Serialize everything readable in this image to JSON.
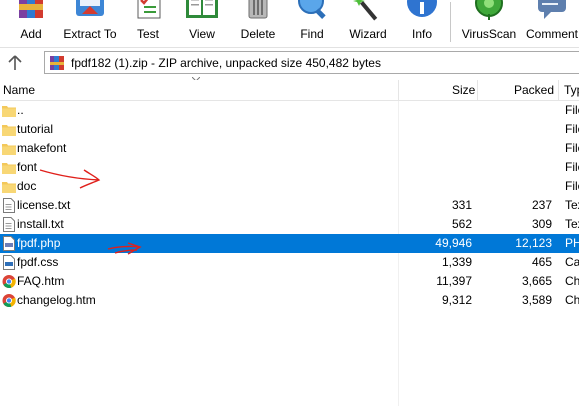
{
  "toolbar": {
    "buttons": [
      {
        "label": "Add",
        "icon": "winrar-books-icon"
      },
      {
        "label": "Extract To",
        "icon": "extract-folder-icon"
      },
      {
        "label": "Test",
        "icon": "test-checklist-icon"
      },
      {
        "label": "View",
        "icon": "open-book-icon"
      },
      {
        "label": "Delete",
        "icon": "trash-can-icon"
      },
      {
        "label": "Find",
        "icon": "magnifier-icon"
      },
      {
        "label": "Wizard",
        "icon": "magic-wand-icon"
      },
      {
        "label": "Info",
        "icon": "info-icon"
      },
      {
        "label": "VirusScan",
        "icon": "virus-scan-icon"
      },
      {
        "label": "Comment",
        "icon": "comment-icon"
      }
    ]
  },
  "address": {
    "path": "fpdf182 (1).zip - ZIP archive, unpacked size 450,482 bytes",
    "icon": "winrar-archive-icon",
    "up_icon": "up-arrow-icon"
  },
  "columns": {
    "name": "Name",
    "size": "Size",
    "packed": "Packed",
    "type": "Typ"
  },
  "files": [
    {
      "name": "..",
      "size": "",
      "packed": "",
      "type": "File",
      "icon": "folder-icon"
    },
    {
      "name": "tutorial",
      "size": "",
      "packed": "",
      "type": "File",
      "icon": "folder-icon"
    },
    {
      "name": "makefont",
      "size": "",
      "packed": "",
      "type": "File",
      "icon": "folder-icon"
    },
    {
      "name": "font",
      "size": "",
      "packed": "",
      "type": "File",
      "icon": "folder-icon"
    },
    {
      "name": "doc",
      "size": "",
      "packed": "",
      "type": "File",
      "icon": "folder-icon"
    },
    {
      "name": "license.txt",
      "size": "331",
      "packed": "237",
      "type": "Tex",
      "icon": "text-file-icon"
    },
    {
      "name": "install.txt",
      "size": "562",
      "packed": "309",
      "type": "Tex",
      "icon": "text-file-icon"
    },
    {
      "name": "fpdf.php",
      "size": "49,946",
      "packed": "12,123",
      "type": "PH",
      "icon": "php-file-icon",
      "selected": true
    },
    {
      "name": "fpdf.css",
      "size": "1,339",
      "packed": "465",
      "type": "Ca",
      "icon": "css-file-icon"
    },
    {
      "name": "FAQ.htm",
      "size": "11,397",
      "packed": "3,665",
      "type": "Ch",
      "icon": "chrome-icon"
    },
    {
      "name": "changelog.htm",
      "size": "9,312",
      "packed": "3,589",
      "type": "Ch",
      "icon": "chrome-icon"
    }
  ],
  "colors": {
    "selection": "#0078d7",
    "folder": "#f3c85a",
    "annotation": "#e0201b"
  }
}
